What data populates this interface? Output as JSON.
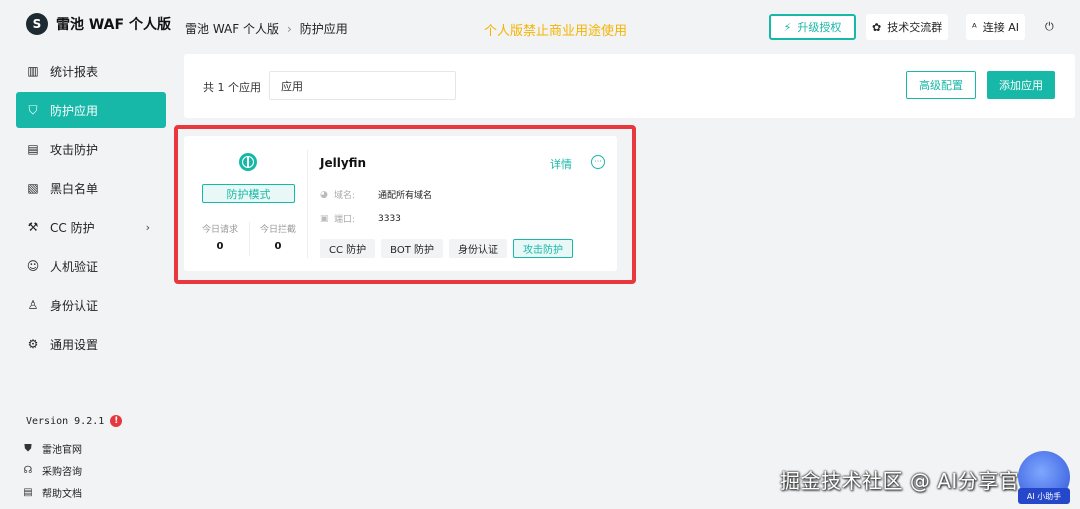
{
  "app": {
    "title": "雷池 WAF 个人版",
    "logo_glyph": "S"
  },
  "sidebar": {
    "items": [
      {
        "label": "统计报表",
        "icon": "bar-chart-icon",
        "glyph": "▥"
      },
      {
        "label": "防护应用",
        "icon": "shield-icon",
        "glyph": "⛉",
        "active": true
      },
      {
        "label": "攻击防护",
        "icon": "clipboard-icon",
        "glyph": "▤"
      },
      {
        "label": "黑白名单",
        "icon": "list-percent-icon",
        "glyph": "▧"
      },
      {
        "label": "CC 防护",
        "icon": "hammer-icon",
        "glyph": "⚒",
        "has_children": true,
        "chevron": "›"
      },
      {
        "label": "人机验证",
        "icon": "user-check-icon",
        "glyph": "☺"
      },
      {
        "label": "身份认证",
        "icon": "person-icon",
        "glyph": "♙"
      },
      {
        "label": "通用设置",
        "icon": "gear-icon",
        "glyph": "⚙"
      }
    ],
    "version": "Version 9.2.1",
    "version_alert": "!",
    "footer_links": [
      {
        "label": "雷池官网",
        "icon": "safeline-shield-icon",
        "glyph": "⛊"
      },
      {
        "label": "采购咨询",
        "icon": "headset-icon",
        "glyph": "☊"
      },
      {
        "label": "帮助文档",
        "icon": "document-icon",
        "glyph": "▤"
      }
    ]
  },
  "header": {
    "breadcrumb": [
      "雷池 WAF 个人版",
      "防护应用"
    ],
    "breadcrumb_sep": "›",
    "notice": "个人版禁止商业用途使用",
    "upgrade_label": "升级授权",
    "upgrade_glyph": "⚡",
    "group_label": "技术交流群",
    "group_glyph": "✿",
    "ai_label": "连接 AI",
    "ai_glyph": "ᴬ",
    "logout_glyph": "⏻"
  },
  "filter": {
    "count_text": "共 1 个应用",
    "search_value": "应用",
    "advanced_label": "高级配置",
    "add_label": "添加应用"
  },
  "app_card": {
    "mode": "防护模式",
    "today_requests_label": "今日请求",
    "today_requests": "0",
    "today_blocked_label": "今日拦截",
    "today_blocked": "0",
    "name": "Jellyfin",
    "detail_label": "详情",
    "more_glyph": "···",
    "domain_glyph": "◕",
    "domain_key": "域名:",
    "domain_value": "通配所有域名",
    "port_glyph": "▣",
    "port_key": "端口:",
    "port_value": "3333",
    "tags": [
      {
        "label": "CC 防护",
        "on": false
      },
      {
        "label": "BOT 防护",
        "on": false
      },
      {
        "label": "身份认证",
        "on": false
      },
      {
        "label": "攻击防护",
        "on": true
      }
    ]
  },
  "watermark": "掘金技术社区 @ AI分享官",
  "assistant_label": "AI 小助手",
  "colors": {
    "accent": "#18b8a8",
    "notice": "#f5b400",
    "highlight": "#e8383d"
  }
}
